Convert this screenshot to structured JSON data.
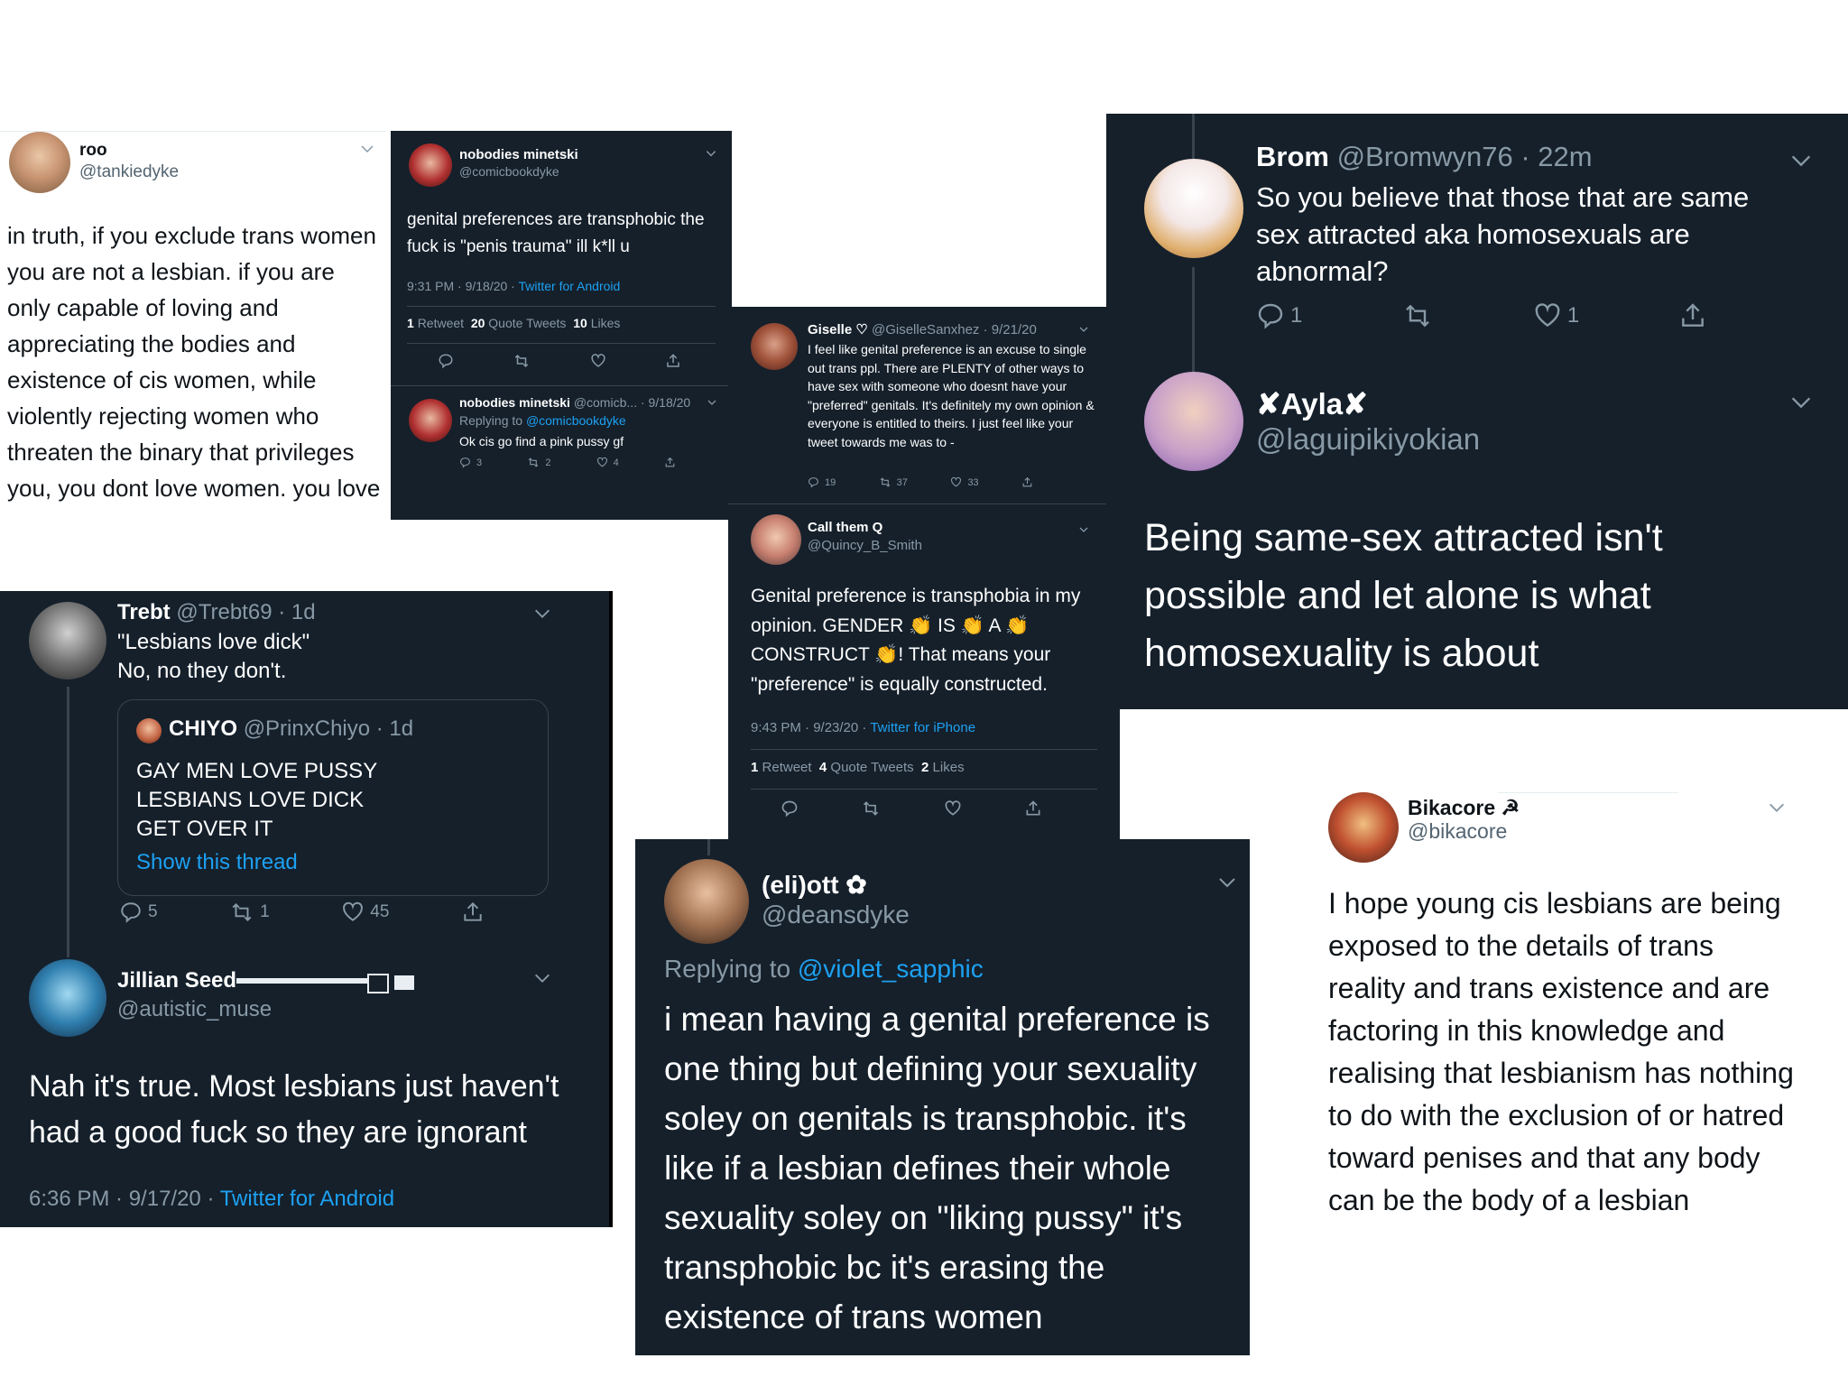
{
  "roo": {
    "name": "roo",
    "handle": "@tankiedyke",
    "text": "in truth, if you exclude trans women you are not a lesbian. if you are only capable of loving and appreciating the bodies and existence of cis women, while violently rejecting women who threaten the binary that privileges you, you dont love women. you love cisness."
  },
  "nobodies1": {
    "name": "nobodies minetski",
    "handle": "@comicbookdyke",
    "text": "genital preferences are transphobic the fuck is \"penis trauma\" ill k*ll u",
    "meta_time": "9:31 PM · 9/18/20 · ",
    "meta_source": "Twitter for Android",
    "retweets": "1",
    "retweets_label": "Retweet",
    "quotes": "20",
    "quotes_label": "Quote Tweets",
    "likes": "10",
    "likes_label": "Likes"
  },
  "nobodies2": {
    "name": "nobodies minetski",
    "handle_date": "@comicb... · 9/18/20",
    "replying_prefix": "Replying to ",
    "replying_to": "@comicbookdyke",
    "text": "Ok cis go find a pink pussy gf",
    "replies": "3",
    "retweets": "2",
    "likes": "4"
  },
  "giselle": {
    "name": "Giselle ♡",
    "handle_date": "@GiselleSanxhez · 9/21/20",
    "text": "I feel like genital preference is an excuse to single out trans ppl. There are PLENTY of other ways to have sex with someone who doesnt have your \"preferred\" genitals. It's definitely my own opinion & everyone is entitled to theirs. I just feel like your tweet towards me was to -",
    "replies": "19",
    "retweets": "37",
    "likes": "33"
  },
  "quincy": {
    "name": "Call them Q",
    "handle": "@Quincy_B_Smith",
    "text": "Genital preference is transphobia in my opinion. GENDER 👏 IS 👏 A 👏 CONSTRUCT 👏! That means your \"preference\" is equally constructed.",
    "meta_time": "9:43 PM · 9/23/20 · ",
    "meta_source": "Twitter for iPhone",
    "retweets": "1",
    "retweets_label": "Retweet",
    "quotes": "4",
    "quotes_label": "Quote Tweets",
    "likes": "2",
    "likes_label": "Likes"
  },
  "brom": {
    "name": "Brom",
    "handle_time": "@Bromwyn76 · 22m",
    "text": "So you believe that those that are same sex attracted aka homosexuals are abnormal?",
    "replies": "1",
    "likes": "1"
  },
  "ayla": {
    "name": "✘Ayla✘",
    "handle": "@laguipikiyokian",
    "text": "Being same-sex attracted isn't possible and let alone is what homosexuality is about"
  },
  "trebt": {
    "name": "Trebt",
    "handle_time": "@Trebt69 · 1d",
    "line1": "\"Lesbians love dick\"",
    "line2": "No, no they don't.",
    "replies": "5",
    "retweets": "1",
    "likes": "45"
  },
  "chiyo": {
    "name": "CHIYO",
    "handle_time": "@PrinxChiyo · 1d",
    "line1": "GAY MEN LOVE PUSSY",
    "line2": "LESBIANS LOVE DICK",
    "line3": "GET OVER IT",
    "show_thread": "Show this thread"
  },
  "jillian": {
    "name": "Jillian Seed",
    "handle": "@autistic_muse",
    "text": "Nah it's true. Most lesbians just haven't had a good fuck so they are ignorant",
    "meta_time": "6:36 PM · 9/17/20 · ",
    "meta_source": "Twitter for Android"
  },
  "eliott": {
    "name": "(eli)ott ✿",
    "handle": "@deansdyke",
    "replying_prefix": "Replying to ",
    "replying_to": "@violet_sapphic",
    "text": "i mean having a genital preference is one thing but defining your sexuality soley on genitals is transphobic. it's like if a lesbian defines their whole sexuality soley on \"liking pussy\" it's transphobic bc it's erasing the existence of trans women"
  },
  "bikacore": {
    "name": "Bikacore ☭",
    "handle": "@bikacore",
    "text": "I hope young cis lesbians are being exposed to the details of trans reality and trans existence and are factoring in this knowledge and realising that lesbianism has nothing to do with the exclusion of or hatred toward penises and that any body can be the body of a lesbian"
  },
  "colors": {
    "dark_bg": "#15202b",
    "link": "#1da1f2",
    "muted": "#8899a6",
    "light_bg": "#ffffff"
  },
  "icons": [
    "reply-icon",
    "retweet-icon",
    "like-icon",
    "share-icon",
    "chevron-down-icon"
  ]
}
